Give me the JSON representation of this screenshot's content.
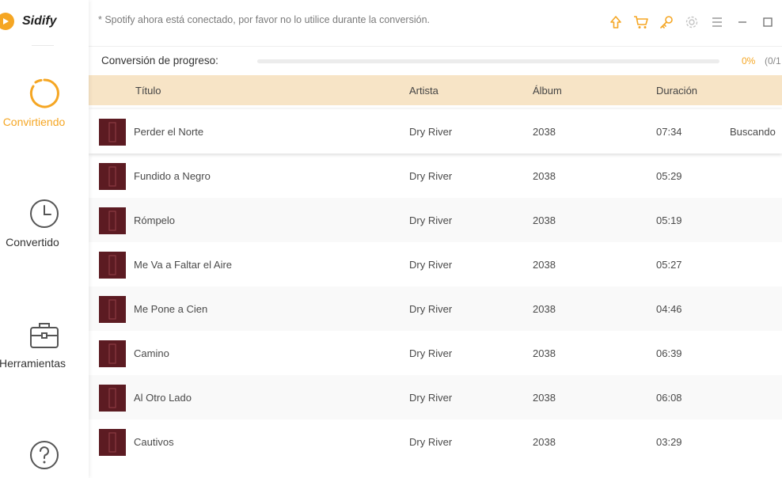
{
  "app": {
    "name": "Sidify"
  },
  "sidebar": {
    "items": [
      {
        "label": "Convirtiendo",
        "icon": "converting-ring-icon",
        "active": true
      },
      {
        "label": "Convertido",
        "icon": "clock-icon",
        "active": false
      },
      {
        "label": "Herramientas",
        "icon": "toolbox-icon",
        "active": false
      },
      {
        "label": "",
        "icon": "help-icon",
        "active": false
      }
    ]
  },
  "header": {
    "notice": "* Spotify ahora está conectado, por favor no lo utilice durante la conversión.",
    "toolbar": [
      "upgrade-arrow-icon",
      "cart-icon",
      "key-icon",
      "settings-gear-icon",
      "menu-icon",
      "minimize-icon",
      "maximize-icon"
    ]
  },
  "progress": {
    "label": "Conversión de progreso:",
    "value": 0,
    "percent_text": "0%",
    "count_text": "(0/1"
  },
  "table": {
    "columns": {
      "title": "Título",
      "artist": "Artista",
      "album": "Álbum",
      "duration": "Duración"
    },
    "rows": [
      {
        "title": "Perder el Norte",
        "artist": "Dry River",
        "album": "2038",
        "duration": "07:34",
        "status": "Buscando"
      },
      {
        "title": "Fundido a Negro",
        "artist": "Dry River",
        "album": "2038",
        "duration": "05:29",
        "status": ""
      },
      {
        "title": "Rómpelo",
        "artist": "Dry River",
        "album": "2038",
        "duration": "05:19",
        "status": ""
      },
      {
        "title": "Me Va a Faltar el Aire",
        "artist": "Dry River",
        "album": "2038",
        "duration": "05:27",
        "status": ""
      },
      {
        "title": "Me Pone a Cien",
        "artist": "Dry River",
        "album": "2038",
        "duration": "04:46",
        "status": ""
      },
      {
        "title": "Camino",
        "artist": "Dry River",
        "album": "2038",
        "duration": "06:39",
        "status": ""
      },
      {
        "title": "Al Otro Lado",
        "artist": "Dry River",
        "album": "2038",
        "duration": "06:08",
        "status": ""
      },
      {
        "title": "Cautivos",
        "artist": "Dry River",
        "album": "2038",
        "duration": "03:29",
        "status": ""
      }
    ]
  },
  "colors": {
    "accent": "#f5a623",
    "header_bg": "#f7e4c6",
    "cover": "#5c1b22"
  }
}
